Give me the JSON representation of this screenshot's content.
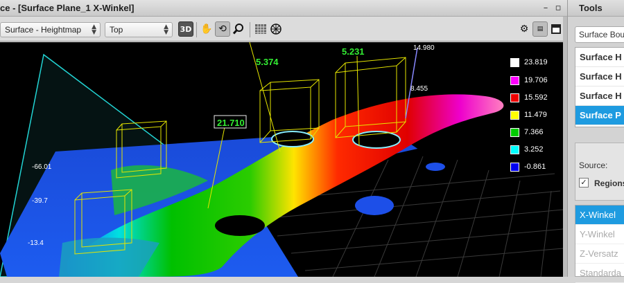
{
  "window": {
    "title": "ce - [Surface Plane_1 X-Winkel]",
    "minimize_glyph": "–",
    "maximize_glyph": "▫"
  },
  "toolbar": {
    "view_mode": "Surface - Heightmap",
    "orientation": "Top",
    "view3d_label": "3D",
    "icons": [
      "pan-hand-icon",
      "rotate-3d-icon",
      "zoom-magnifier-icon",
      "grid-toggle-icon",
      "wireframe-icon",
      "settings-gear-icon",
      "panel-toggle-icon",
      "window-dock-icon"
    ]
  },
  "viewport": {
    "measurements": [
      {
        "label": "21.710",
        "color": "#33ee33"
      },
      {
        "label": "5.374",
        "color": "#33ee33"
      },
      {
        "label": "5.231",
        "color": "#33ee33"
      }
    ],
    "axis_labels": {
      "top": "14.980",
      "top2": "8.455",
      "left": [
        "-66.01",
        "-39.7",
        "-13.4"
      ]
    },
    "legend": [
      {
        "value": "23.819",
        "color": "#ffffff"
      },
      {
        "value": "19.706",
        "color": "#ff00ff"
      },
      {
        "value": "15.592",
        "color": "#ee0000"
      },
      {
        "value": "11.479",
        "color": "#ffff00"
      },
      {
        "value": "7.366",
        "color": "#00cc00"
      },
      {
        "value": "3.252",
        "color": "#00ffff"
      },
      {
        "value": "-0.861",
        "color": "#0000ee"
      }
    ]
  },
  "tools_panel": {
    "header": "Tools",
    "combo_value": "Surface Bou",
    "tool_list": [
      {
        "label": "Surface H",
        "selected": false
      },
      {
        "label": "Surface H",
        "selected": false
      },
      {
        "label": "Surface H",
        "selected": false
      },
      {
        "label": "Surface P",
        "selected": true
      }
    ],
    "source_label": "Source:",
    "regions_checked": "✓",
    "regions_label": "Regions",
    "measure_list": [
      {
        "label": "X-Winkel",
        "selected": true
      },
      {
        "label": "Y-Winkel",
        "selected": false
      },
      {
        "label": "Z-Versatz",
        "selected": false
      },
      {
        "label": "Standarda",
        "selected": false
      }
    ]
  }
}
